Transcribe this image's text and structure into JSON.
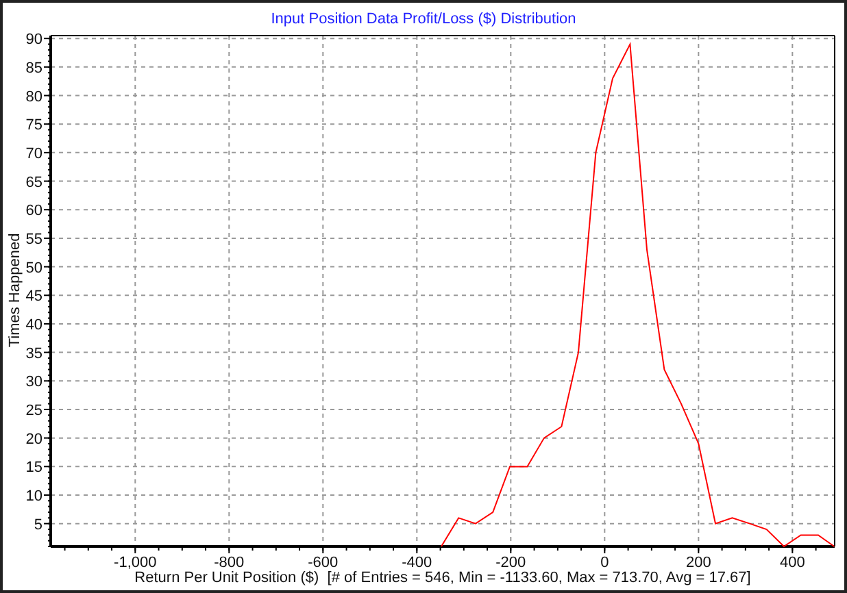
{
  "chart_data": {
    "type": "line",
    "title": "Input Position Data Profit/Loss ($) Distribution",
    "xlabel": "Return Per Unit Position ($)  [# of Entries = 546, Min = -1133.60, Max = 713.70, Avg = 17.67]",
    "ylabel": "Times Happened",
    "x": [
      -348,
      -311,
      -275,
      -238,
      -202,
      -165,
      -129,
      -92,
      -56,
      -19,
      17,
      54,
      90,
      127,
      163,
      200,
      236,
      272,
      309,
      345,
      382,
      418,
      455,
      489
    ],
    "grid": true,
    "series": [
      {
        "color": "#ff0000",
        "values": [
          1,
          6,
          5,
          7,
          15,
          15,
          20,
          22,
          35,
          70,
          83,
          89,
          53,
          32,
          26,
          19,
          5,
          6,
          5,
          4,
          1,
          3,
          3,
          1
        ]
      }
    ],
    "xlim": [
      -1180,
      490
    ],
    "ylim": [
      1,
      90.5
    ],
    "xticks": [
      {
        "value": -1000,
        "label": "-1,000"
      },
      {
        "value": -800,
        "label": "-800"
      },
      {
        "value": -600,
        "label": "-600"
      },
      {
        "value": -400,
        "label": "-400"
      },
      {
        "value": -200,
        "label": "-200"
      },
      {
        "value": 0,
        "label": "0"
      },
      {
        "value": 200,
        "label": "200"
      },
      {
        "value": 400,
        "label": "400"
      }
    ],
    "yticks": [
      5,
      10,
      15,
      20,
      25,
      30,
      35,
      40,
      45,
      50,
      55,
      60,
      65,
      70,
      75,
      80,
      85,
      90
    ]
  }
}
